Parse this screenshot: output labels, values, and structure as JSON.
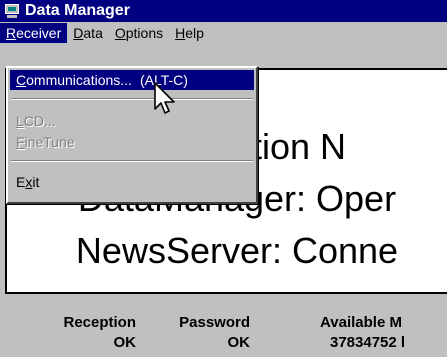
{
  "window": {
    "title": "Data Manager",
    "icon": "computer-icon"
  },
  "menubar": [
    {
      "label": "Receiver",
      "mnemonic": "R"
    },
    {
      "label": "Data",
      "mnemonic": "D"
    },
    {
      "label": "Options",
      "mnemonic": "O"
    },
    {
      "label": "Help",
      "mnemonic": "H"
    }
  ],
  "receiver_menu": {
    "items": [
      {
        "label": "Communications...",
        "shortcut": "(ALT-C)",
        "enabled": true,
        "highlighted": true
      },
      {
        "label": "LCD...",
        "enabled": false
      },
      {
        "label": "FineTune",
        "enabled": false
      },
      {
        "label": "Exit",
        "enabled": true
      }
    ]
  },
  "status": {
    "line1": "Connection N",
    "line2": "DataManager: Oper",
    "line3": "NewsServer:  Conne"
  },
  "stats": {
    "headers": [
      "Reception",
      "Password",
      "Available M"
    ],
    "values": [
      "OK",
      "OK",
      "37834752 l"
    ]
  }
}
